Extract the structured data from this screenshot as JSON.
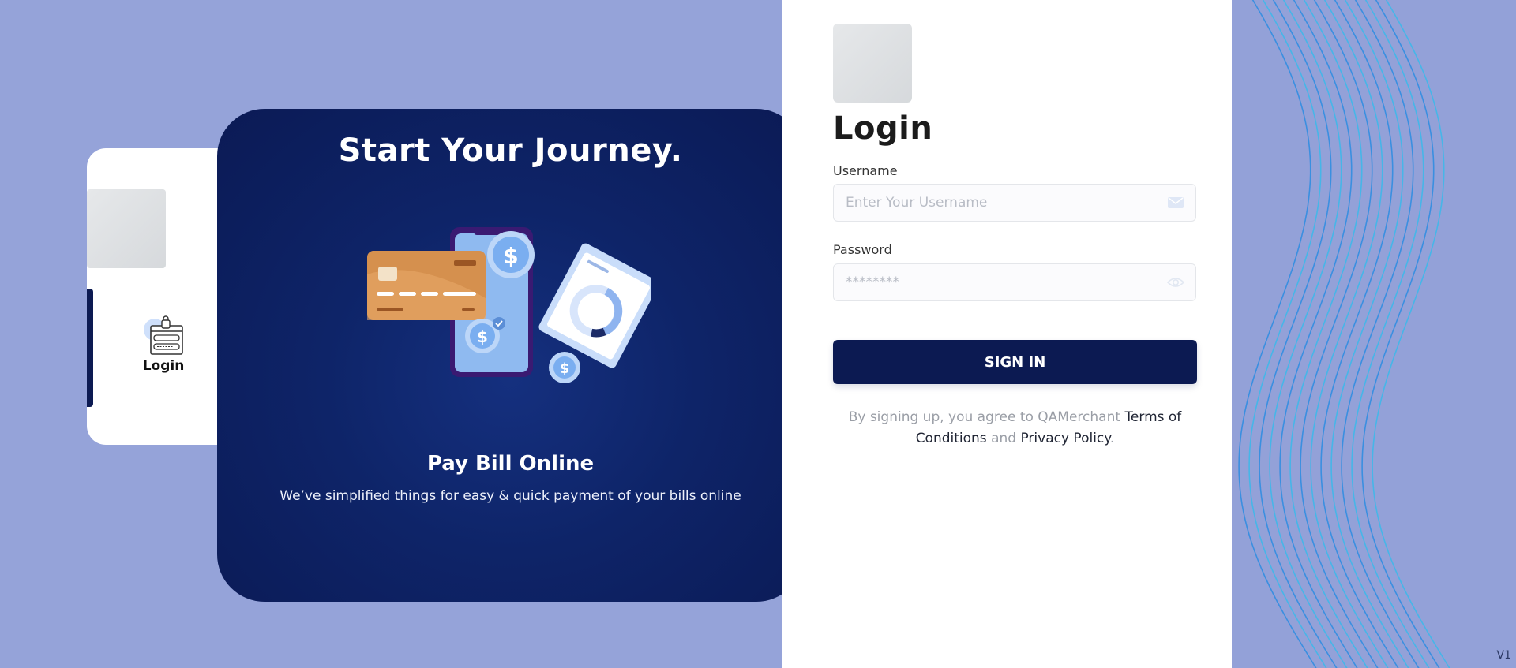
{
  "hero": {
    "title": "Start Your Journey.",
    "subtitle": "Pay Bill Online",
    "description": "We’ve simplified things for easy & quick payment of your bills online"
  },
  "sidebar": {
    "items": [
      {
        "label": "Login",
        "icon": "login-form-icon",
        "active": true
      }
    ]
  },
  "login": {
    "title": "Login",
    "username_label": "Username",
    "username_placeholder": "Enter Your Username",
    "username_value": "",
    "password_label": "Password",
    "password_placeholder": "********",
    "password_value": "",
    "submit_label": "SIGN IN",
    "terms_prefix": "By signing up, you agree to QAMerchant ",
    "terms_link": "Terms of Conditions",
    "terms_middle": " and ",
    "privacy_link": "Privacy Policy",
    "terms_suffix": "."
  },
  "footer": {
    "version": "V1"
  },
  "colors": {
    "background": "#95a3d9",
    "primary": "#0c1a52",
    "hero_bg": "#0e2468",
    "wave_line": "#3a8fe0"
  }
}
